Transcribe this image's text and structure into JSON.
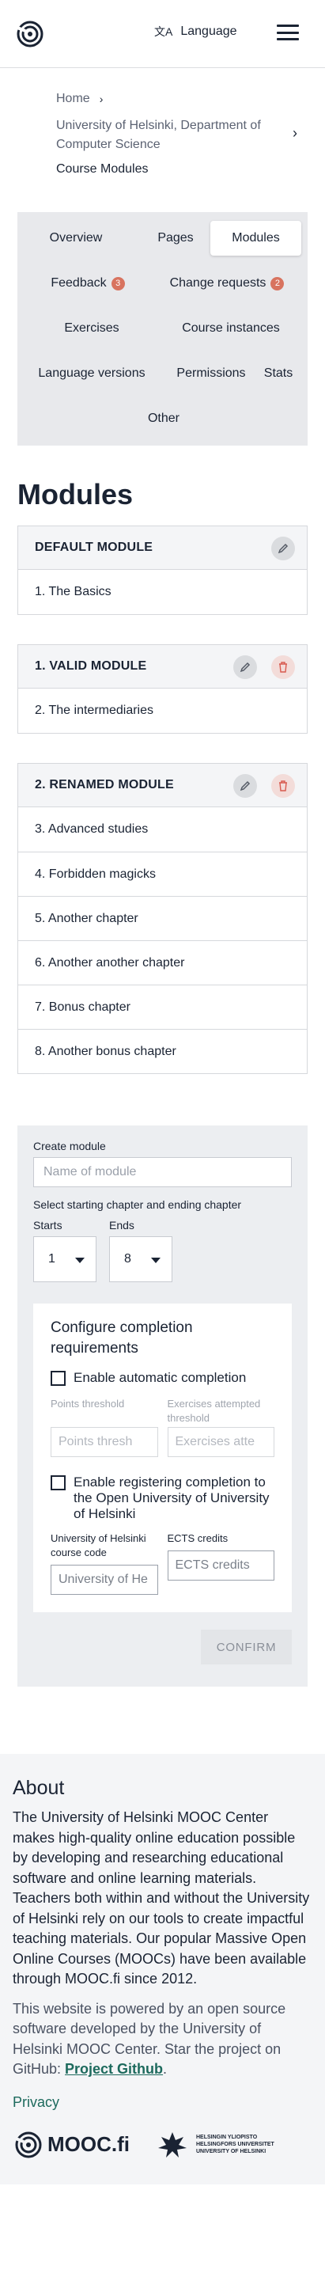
{
  "header": {
    "language_label": "Language",
    "language_glyph": "文A"
  },
  "breadcrumb": {
    "home": "Home",
    "department": "University of Helsinki, Department of Computer Science",
    "current": "Course Modules"
  },
  "tabs": {
    "overview": "Overview",
    "pages": "Pages",
    "modules": "Modules",
    "feedback": "Feedback",
    "feedback_count": "3",
    "change_requests": "Change requests",
    "change_requests_count": "2",
    "exercises": "Exercises",
    "course_instances": "Course instances",
    "language_versions": "Language versions",
    "permissions": "Permissions",
    "stats": "Stats",
    "other": "Other"
  },
  "page_title": "Modules",
  "modules": [
    {
      "name": "DEFAULT MODULE",
      "chapters": [
        "1. The Basics"
      ]
    },
    {
      "name": "1. VALID MODULE",
      "chapters": [
        "2. The intermediaries"
      ]
    },
    {
      "name": "2. RENAMED MODULE",
      "chapters": [
        "3. Advanced studies",
        "4. Forbidden magicks",
        "5. Another chapter",
        "6. Another another chapter",
        "7. Bonus chapter",
        "8. Another bonus chapter"
      ]
    }
  ],
  "create_form": {
    "create_label": "Create module",
    "name_placeholder": "Name of module",
    "chapter_select_label": "Select starting chapter and ending chapter",
    "starts_label": "Starts",
    "starts_value": "1",
    "ends_label": "Ends",
    "ends_value": "8",
    "completion_title": "Configure completion requirements",
    "enable_auto": "Enable automatic completion",
    "points_threshold_label": "Points threshold",
    "points_threshold_placeholder": "Points thresh",
    "exercises_attempted_label": "Exercises attempted threshold",
    "exercises_attempted_placeholder": "Exercises atte",
    "enable_registering": "Enable registering completion to the Open University of University of Helsinki",
    "uh_course_code_label": "University of Helsinki course code",
    "uh_course_code_placeholder": "University of He",
    "ects_label": "ECTS credits",
    "ects_placeholder": "ECTS credits",
    "confirm": "CONFIRM"
  },
  "footer": {
    "about_title": "About",
    "about_body": "The University of Helsinki MOOC Center makes high-quality online education possible by developing and researching educational software and online learning materials. Teachers both within and without the University of Helsinki rely on our tools to create impactful teaching materials. Our popular Massive Open Online Courses (MOOCs) have been available through MOOC.fi since 2012.",
    "powered_by": "This website is powered by an open source software developed by the University of Helsinki MOOC Center. Star the project on GitHub: ",
    "project_link": "Project Github",
    "period": ".",
    "privacy": "Privacy",
    "mooc_logo_text": "MOOC.fi",
    "uh_logo_line1": "HELSINGIN YLIOPISTO",
    "uh_logo_line2": "HELSINGFORS UNIVERSITET",
    "uh_logo_line3": "UNIVERSITY OF HELSINKI"
  },
  "colors": {
    "badge": "#d8735f",
    "link": "#1d6a5d",
    "delete_icon": "#d85a4f"
  }
}
